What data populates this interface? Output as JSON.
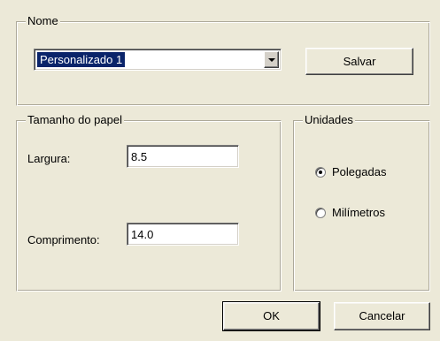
{
  "name_group": {
    "label": "Nome",
    "selected_value": "Personalizado 1",
    "save_label": "Salvar"
  },
  "paper_group": {
    "label": "Tamanho do papel",
    "width_label": "Largura:",
    "width_value": "8.5",
    "length_label": "Comprimento:",
    "length_value": "14.0"
  },
  "units_group": {
    "label": "Unidades",
    "options": [
      {
        "label": "Polegadas",
        "selected": true
      },
      {
        "label": "Milímetros",
        "selected": false
      }
    ]
  },
  "footer": {
    "ok_label": "OK",
    "cancel_label": "Cancelar"
  },
  "icons": {
    "combo_arrow": "chevron-down-icon",
    "radio": "radio-button-icon"
  }
}
